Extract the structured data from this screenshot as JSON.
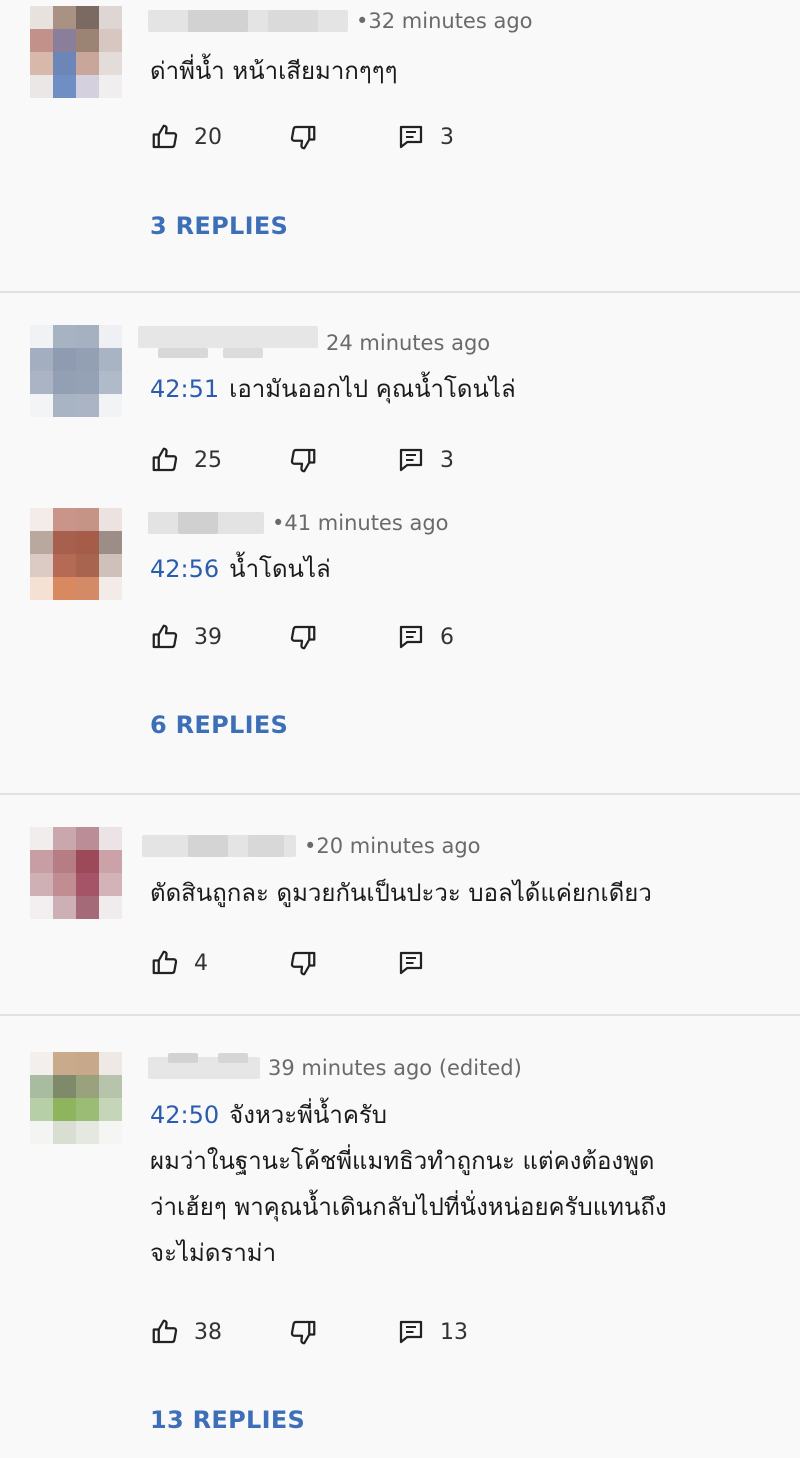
{
  "comments": [
    {
      "time": "32 minutes ago",
      "edited": "",
      "timestamp_link": "",
      "lines": [
        "ด่าพี่น้ำ หน้าเสียมากๆๆๆ"
      ],
      "likes": "20",
      "reply_count": "3",
      "replies_link": "3 REPLIES",
      "avatar_colors": [
        "#e8e2df",
        "#a99284",
        "#7a6a62",
        "#ded6d2",
        "#c2928a",
        "#8a7f9a",
        "#9b8474",
        "#d8c7c0",
        "#d9b8ac",
        "#6d86b8",
        "#c9a69a",
        "#e4dcd8",
        "#ebe7e6",
        "#6f8fc4",
        "#d4d0dd",
        "#f0eeee"
      ]
    },
    {
      "time": "24 minutes ago",
      "edited": "",
      "timestamp_link": "42:51",
      "lines": [
        "เอามันออกไป  คุณน้ำโดนไล่"
      ],
      "likes": "25",
      "reply_count": "3",
      "replies_link": "",
      "avatar_colors": [
        "#f1f2f4",
        "#a7b2c2",
        "#a5b0c1",
        "#eef0f3",
        "#a3afc0",
        "#8e9bb0",
        "#93a0b4",
        "#a8b3c3",
        "#aab4c4",
        "#93a0b4",
        "#95a2b5",
        "#b0bac9",
        "#f3f4f6",
        "#a8b3c3",
        "#aab4c4",
        "#f2f3f5"
      ]
    },
    {
      "time": "41 minutes ago",
      "edited": "",
      "timestamp_link": "42:56",
      "lines": [
        "น้ำโดนไล่"
      ],
      "likes": "39",
      "reply_count": "6",
      "replies_link": "6 REPLIES",
      "avatar_colors": [
        "#f3ece9",
        "#c9958a",
        "#c59486",
        "#ece3e0",
        "#b8a89e",
        "#a8604e",
        "#a55c48",
        "#9c8d86",
        "#dccbc4",
        "#b46a55",
        "#a8644e",
        "#cfc0ba",
        "#f5e0d4",
        "#d9895f",
        "#d38a66",
        "#f3ebe7"
      ]
    },
    {
      "time": "20 minutes ago",
      "edited": "",
      "timestamp_link": "",
      "lines": [
        "ตัดสินถูกละ ดูมวยกันเป็นปะวะ บอลได้แค่ยกเดียว"
      ],
      "likes": "4",
      "reply_count": "",
      "replies_link": "",
      "avatar_colors": [
        "#f2eded",
        "#c9a7ad",
        "#bb8e97",
        "#ebe3e5",
        "#c79ea3",
        "#b77d84",
        "#9c4a5a",
        "#caa2a8",
        "#cfb0b4",
        "#c28c93",
        "#a45466",
        "#d4b3b8",
        "#f3eff0",
        "#cdb0b5",
        "#a46a78",
        "#f0ebec"
      ]
    },
    {
      "time": "39 minutes ago",
      "edited": "(edited)",
      "timestamp_link": "42:50",
      "lines": [
        "จังหวะพี่น้ำครับ",
        "ผมว่าในฐานะโค้ชพี่แมทธิวทำถูกนะ   แต่คงต้องพูด",
        "ว่าเฮ้ยๆ พาคุณน้ำเดินกลับไปที่นั่งหน่อยครับแทนถึง",
        "จะไม่ดราม่า"
      ],
      "likes": "38",
      "reply_count": "13",
      "replies_link": "13 REPLIES",
      "avatar_colors": [
        "#f2efec",
        "#c9ab8c",
        "#c7a88b",
        "#eee9e4",
        "#a8bca0",
        "#7f8a6a",
        "#9aa17d",
        "#b7c4ac",
        "#b6cfa6",
        "#8fb45e",
        "#9bbc74",
        "#c5d6b8",
        "#f4f5f2",
        "#d8dfd2",
        "#e4e8e0",
        "#f5f6f3"
      ]
    }
  ],
  "icons": {
    "like": "thumb-up-icon",
    "dislike": "thumb-down-icon",
    "reply": "reply-icon"
  },
  "colors": {
    "link": "#3d6fb8",
    "timestamp": "#2a5db0",
    "meta": "#6a6a6a",
    "divider": "#e2e2e2"
  }
}
